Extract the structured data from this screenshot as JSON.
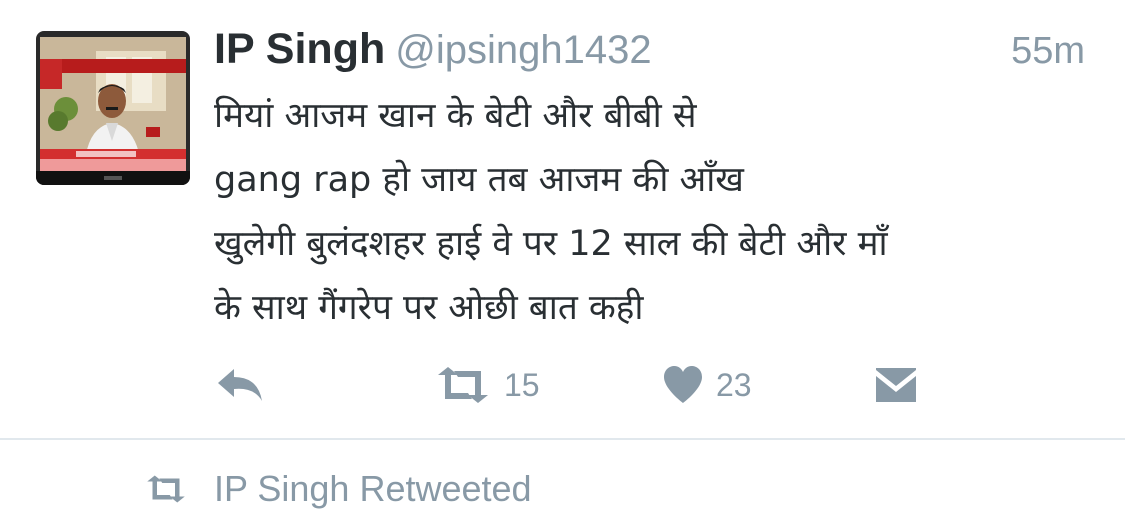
{
  "tweet": {
    "display_name": "IP Singh",
    "handle": "@ipsingh1432",
    "time": "55m",
    "text_lines": [
      "मियां आजम खान के बेटी और बीबी से",
      "gang rap हो जाय तब आजम की आँख",
      "खुलेगी बुलंदशहर हाई वे पर 12 साल की बेटी और माँ",
      "के साथ गैंगरेप पर ओछी बात कही"
    ],
    "avatar_icon": "profile-photo-news-screenshot",
    "actions": {
      "reply_icon": "reply-icon",
      "retweet_icon": "retweet-icon",
      "retweet_count": "15",
      "like_icon": "heart-icon",
      "like_count": "23",
      "dm_icon": "envelope-icon"
    }
  },
  "retweeted_context": {
    "icon": "retweet-icon",
    "label": "IP Singh Retweeted"
  },
  "colors": {
    "text": "#292f33",
    "muted": "#8899a6",
    "divider": "#e1e8ed",
    "background": "#ffffff"
  }
}
